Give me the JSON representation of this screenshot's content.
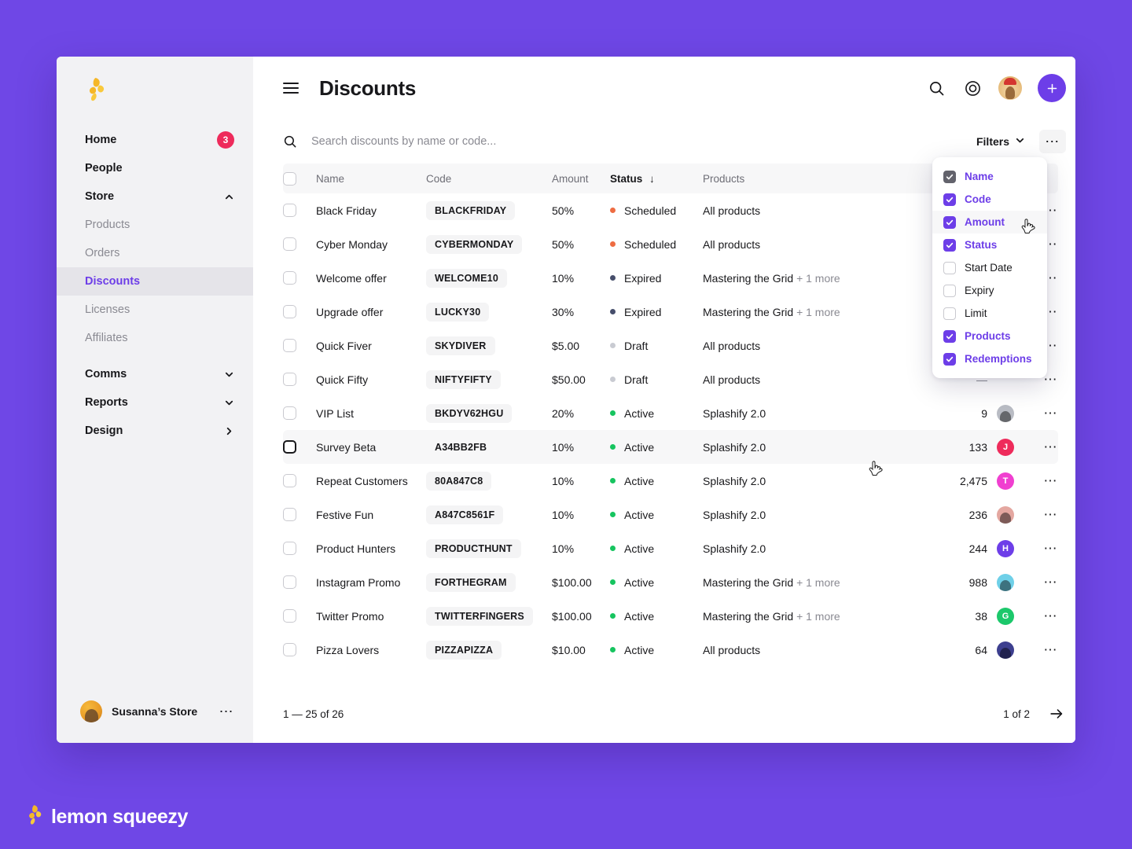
{
  "brand": {
    "name": "lemon squeezy",
    "logo_icon": "lemon-icon",
    "bg_color": "#6F47E6"
  },
  "sidebar": {
    "logo_icon": "lemon-icon",
    "items": [
      {
        "label": "Home",
        "type": "top",
        "badge": "3",
        "icon": null,
        "active": false
      },
      {
        "label": "People",
        "type": "top",
        "badge": null,
        "icon": null,
        "active": false
      },
      {
        "label": "Store",
        "type": "top",
        "badge": null,
        "icon": "chevron-up-icon",
        "active": false
      },
      {
        "label": "Products",
        "type": "sub",
        "badge": null,
        "icon": null,
        "active": false
      },
      {
        "label": "Orders",
        "type": "sub",
        "badge": null,
        "icon": null,
        "active": false
      },
      {
        "label": "Discounts",
        "type": "sub",
        "badge": null,
        "icon": null,
        "active": true
      },
      {
        "label": "Licenses",
        "type": "sub",
        "badge": null,
        "icon": null,
        "active": false
      },
      {
        "label": "Affiliates",
        "type": "sub",
        "badge": null,
        "icon": null,
        "active": false
      },
      {
        "label": "Comms",
        "type": "top",
        "badge": null,
        "icon": "chevron-down-icon",
        "active": false
      },
      {
        "label": "Reports",
        "type": "top",
        "badge": null,
        "icon": "chevron-down-icon",
        "active": false
      },
      {
        "label": "Design",
        "type": "top",
        "badge": null,
        "icon": "chevron-right-icon",
        "active": false
      }
    ],
    "store": {
      "name": "Susanna’s Store",
      "menu_icon": "ellipsis-icon",
      "avatar_icon": "store-avatar"
    }
  },
  "topbar": {
    "menu_icon": "hamburger-icon",
    "title": "Discounts",
    "search_icon": "search-icon",
    "help_icon": "help-target-icon",
    "avatar_icon": "user-avatar",
    "add_icon": "plus-icon"
  },
  "search": {
    "icon": "search-icon",
    "placeholder": "Search discounts by name or code...",
    "value": "",
    "filters_label": "Filters",
    "filters_chevron": "chevron-down-icon",
    "more_icon": "ellipsis-icon"
  },
  "columns_menu": {
    "items": [
      {
        "label": "Name",
        "checked": true,
        "locked": true,
        "hover": false
      },
      {
        "label": "Code",
        "checked": true,
        "locked": false,
        "hover": false
      },
      {
        "label": "Amount",
        "checked": true,
        "locked": false,
        "hover": true
      },
      {
        "label": "Status",
        "checked": true,
        "locked": false,
        "hover": false
      },
      {
        "label": "Start Date",
        "checked": false,
        "locked": false,
        "hover": false
      },
      {
        "label": "Expiry",
        "checked": false,
        "locked": false,
        "hover": false
      },
      {
        "label": "Limit",
        "checked": false,
        "locked": false,
        "hover": false
      },
      {
        "label": "Products",
        "checked": true,
        "locked": false,
        "hover": false
      },
      {
        "label": "Redemptions",
        "checked": true,
        "locked": false,
        "hover": false
      }
    ],
    "accent_color": "#6D3EE8",
    "locked_color": "#63636C"
  },
  "table": {
    "headers": {
      "name": "Name",
      "code": "Code",
      "amount": "Amount",
      "status": "Status",
      "sort_icon": "arrow-down-icon",
      "products": "Products"
    },
    "status_colors": {
      "Scheduled": "#EE6C42",
      "Expired": "#464E6B",
      "Draft": "#C9CBD2",
      "Active": "#16C45F"
    },
    "rows": [
      {
        "name": "Black Friday",
        "code": "BLACKFRIDAY",
        "amount": "50%",
        "status": "Scheduled",
        "products": "All products",
        "products_more": "",
        "redemptions": "",
        "avatar": null,
        "hovered": false
      },
      {
        "name": "Cyber Monday",
        "code": "CYBERMONDAY",
        "amount": "50%",
        "status": "Scheduled",
        "products": "All products",
        "products_more": "",
        "redemptions": "",
        "avatar": null,
        "hovered": false
      },
      {
        "name": "Welcome offer",
        "code": "WELCOME10",
        "amount": "10%",
        "status": "Expired",
        "products": "Mastering the Grid",
        "products_more": "+ 1 more",
        "redemptions": "",
        "avatar": null,
        "hovered": false
      },
      {
        "name": "Upgrade offer",
        "code": "LUCKY30",
        "amount": "30%",
        "status": "Expired",
        "products": "Mastering the Grid",
        "products_more": "+ 1 more",
        "redemptions": "",
        "avatar": null,
        "hovered": false
      },
      {
        "name": "Quick Fiver",
        "code": "SKYDIVER",
        "amount": "$5.00",
        "status": "Draft",
        "products": "All products",
        "products_more": "",
        "redemptions": "",
        "avatar": null,
        "hovered": false
      },
      {
        "name": "Quick Fifty",
        "code": "NIFTYFIFTY",
        "amount": "$50.00",
        "status": "Draft",
        "products": "All products",
        "products_more": "",
        "redemptions": "—",
        "avatar": null,
        "hovered": false
      },
      {
        "name": "VIP List",
        "code": "BKDYV62HGU",
        "amount": "20%",
        "status": "Active",
        "products": "Splashify 2.0",
        "products_more": "",
        "redemptions": "9",
        "avatar": {
          "initial": "",
          "bg": "#B9BCC4",
          "photo": "man-photo"
        },
        "hovered": false
      },
      {
        "name": "Survey Beta",
        "code": "A34BB2FB",
        "amount": "10%",
        "status": "Active",
        "products": "Splashify 2.0",
        "products_more": "",
        "redemptions": "133",
        "avatar": {
          "initial": "J",
          "bg": "#EE2B5B",
          "photo": null
        },
        "hovered": true
      },
      {
        "name": "Repeat Customers",
        "code": "80A847C8",
        "amount": "10%",
        "status": "Active",
        "products": "Splashify 2.0",
        "products_more": "",
        "redemptions": "2,475",
        "avatar": {
          "initial": "T",
          "bg": "#F03FD0",
          "photo": null
        },
        "hovered": false
      },
      {
        "name": "Festive Fun",
        "code": "A847C8561F",
        "amount": "10%",
        "status": "Active",
        "products": "Splashify 2.0",
        "products_more": "",
        "redemptions": "236",
        "avatar": {
          "initial": "",
          "bg": "#E4A7A0",
          "photo": "woman-photo"
        },
        "hovered": false
      },
      {
        "name": "Product Hunters",
        "code": "PRODUCTHUNT",
        "amount": "10%",
        "status": "Active",
        "products": "Splashify 2.0",
        "products_more": "",
        "redemptions": "244",
        "avatar": {
          "initial": "H",
          "bg": "#6D3EE8",
          "photo": null
        },
        "hovered": false
      },
      {
        "name": "Instagram Promo",
        "code": "FORTHEGRAM",
        "amount": "$100.00",
        "status": "Active",
        "products": "Mastering the Grid",
        "products_more": "+ 1 more",
        "redemptions": "988",
        "avatar": {
          "initial": "",
          "bg": "#6FD0E8",
          "photo": "beard-photo"
        },
        "hovered": false
      },
      {
        "name": "Twitter Promo",
        "code": "TWITTERFINGERS",
        "amount": "$100.00",
        "status": "Active",
        "products": "Mastering the Grid",
        "products_more": "+ 1 more",
        "redemptions": "38",
        "avatar": {
          "initial": "G",
          "bg": "#1CC86B",
          "photo": null
        },
        "hovered": false
      },
      {
        "name": "Pizza Lovers",
        "code": "PIZZAPIZZA",
        "amount": "$10.00",
        "status": "Active",
        "products": "All products",
        "products_more": "",
        "redemptions": "64",
        "avatar": {
          "initial": "",
          "bg": "#3D3F8F",
          "photo": "night-photo"
        },
        "hovered": false
      }
    ],
    "row_menu_icon": "ellipsis-icon"
  },
  "footer": {
    "range": "1 — 25 of 26",
    "page": "1 of 2",
    "next_icon": "arrow-right-icon"
  }
}
